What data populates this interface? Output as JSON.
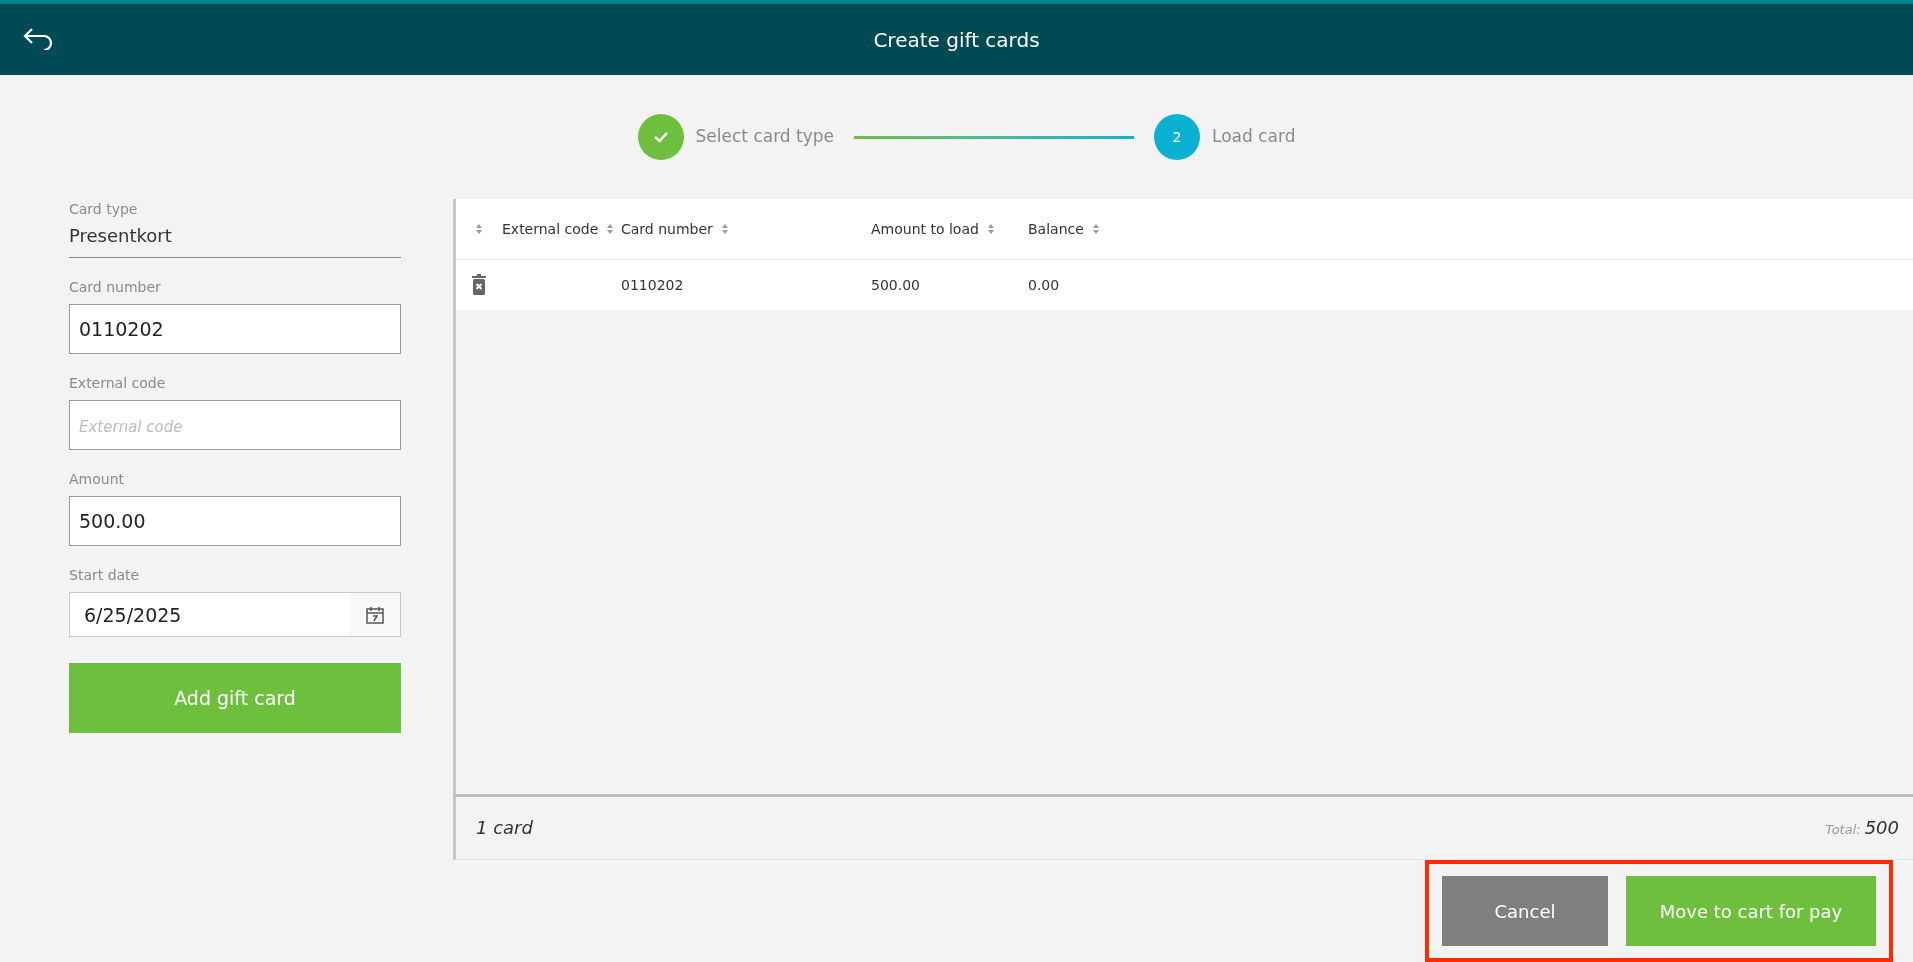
{
  "header": {
    "title": "Create gift cards"
  },
  "steps": [
    {
      "label": "Select card type",
      "completed": true
    },
    {
      "label": "Load card",
      "number": "2",
      "completed": false
    }
  ],
  "form": {
    "card_type": {
      "label": "Card type",
      "value": "Presentkort"
    },
    "fields": [
      {
        "label": "Card number",
        "value": "0110202",
        "kind": "text"
      },
      {
        "label": "External code",
        "placeholder": "External code",
        "kind": "text"
      },
      {
        "label": "Amount",
        "value": "500.00",
        "kind": "text"
      },
      {
        "label": "Start date",
        "value": "6/25/2025",
        "kind": "date"
      }
    ],
    "submit": "Add gift card"
  },
  "table": {
    "columns": [
      "External code",
      "Card number",
      "Amount to load",
      "Balance"
    ],
    "rows": [
      {
        "card_number": "0110202",
        "amount": "500.00",
        "balance": "0.00"
      }
    ]
  },
  "footer": {
    "count": "1 card",
    "total_label": "Total:",
    "total": "500"
  },
  "buttons": {
    "cancel": "Cancel",
    "confirm": "Move to cart for pay"
  }
}
